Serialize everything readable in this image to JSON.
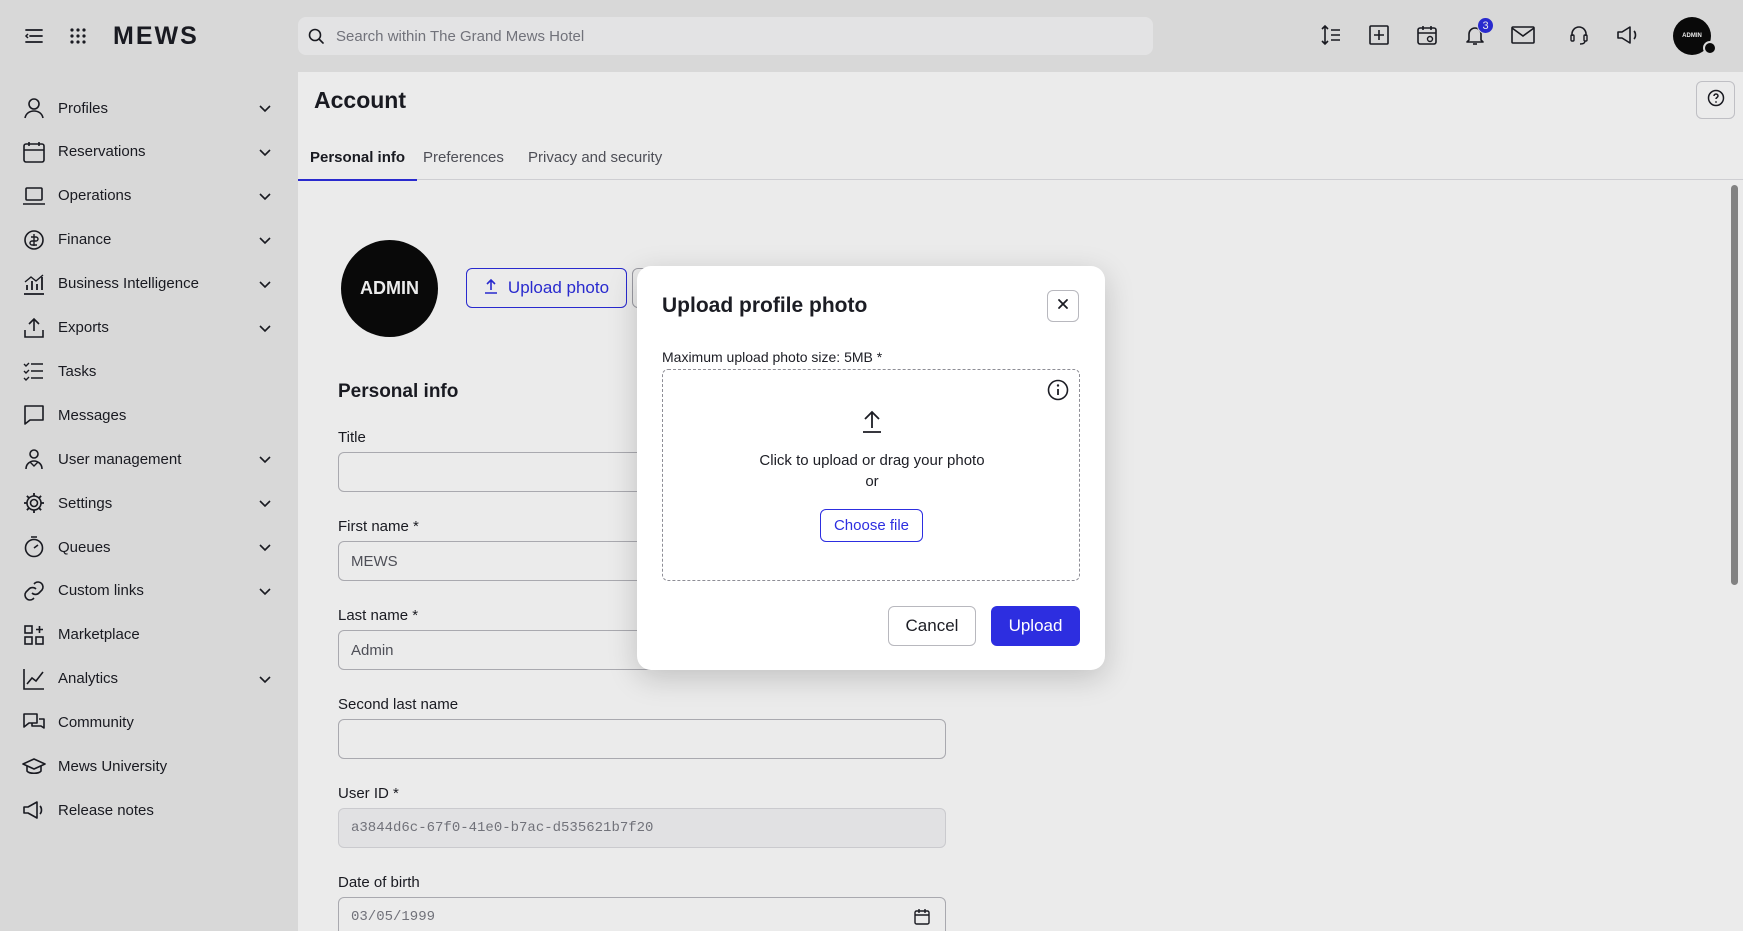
{
  "app": {
    "logo": "MEWS"
  },
  "search": {
    "placeholder": "Search within The Grand Mews Hotel"
  },
  "topbar": {
    "notification_count": "3",
    "avatar_label": "ADMIN",
    "icons": [
      "menu-icon",
      "apps-grid-icon",
      "sort-icon",
      "add-square-icon",
      "calendar-view-icon",
      "bell-icon",
      "mail-icon",
      "support-icon",
      "megaphone-icon"
    ]
  },
  "sidebar": {
    "items": [
      {
        "label": "Profiles",
        "icon": "person-icon",
        "expandable": true
      },
      {
        "label": "Reservations",
        "icon": "calendar-icon",
        "expandable": true
      },
      {
        "label": "Operations",
        "icon": "laptop-icon",
        "expandable": true
      },
      {
        "label": "Finance",
        "icon": "coins-icon",
        "expandable": true
      },
      {
        "label": "Business Intelligence",
        "icon": "bar-chart-icon",
        "expandable": true
      },
      {
        "label": "Exports",
        "icon": "export-icon",
        "expandable": true
      },
      {
        "label": "Tasks",
        "icon": "tasks-icon",
        "expandable": false
      },
      {
        "label": "Messages",
        "icon": "message-icon",
        "expandable": false
      },
      {
        "label": "User management",
        "icon": "users-icon",
        "expandable": true
      },
      {
        "label": "Settings",
        "icon": "gear-icon",
        "expandable": true
      },
      {
        "label": "Queues",
        "icon": "stopwatch-icon",
        "expandable": true
      },
      {
        "label": "Custom links",
        "icon": "link-icon",
        "expandable": true
      },
      {
        "label": "Marketplace",
        "icon": "grid-plus-icon",
        "expandable": false
      },
      {
        "label": "Analytics",
        "icon": "line-chart-icon",
        "expandable": true
      },
      {
        "label": "Community",
        "icon": "chat-bubbles-icon",
        "expandable": false
      },
      {
        "label": "Mews University",
        "icon": "graduation-cap-icon",
        "expandable": false
      },
      {
        "label": "Release notes",
        "icon": "megaphone-icon",
        "expandable": false
      }
    ]
  },
  "main": {
    "title": "Account",
    "tabs": [
      {
        "label": "Personal info",
        "active": true
      },
      {
        "label": "Preferences",
        "active": false
      },
      {
        "label": "Privacy and security",
        "active": false
      }
    ],
    "avatar_label": "ADMIN",
    "upload_photo_label": "Upload photo",
    "section_title": "Personal info",
    "fields": {
      "title": {
        "label": "Title",
        "value": ""
      },
      "first_name": {
        "label": "First name *",
        "value": "MEWS"
      },
      "last_name": {
        "label": "Last name *",
        "value": "Admin"
      },
      "second_last_name": {
        "label": "Second last name",
        "value": ""
      },
      "user_id": {
        "label": "User ID *",
        "value": "a3844d6c-67f0-41e0-b7ac-d535621b7f20"
      },
      "date_of_birth": {
        "label": "Date of birth",
        "value": "03/05/1999"
      }
    }
  },
  "modal": {
    "title": "Upload profile photo",
    "max_size_label": "Maximum upload photo size: 5MB *",
    "dropzone_text": "Click to upload or drag your photo",
    "or_text": "or",
    "choose_file_label": "Choose file",
    "cancel_label": "Cancel",
    "upload_label": "Upload"
  },
  "colors": {
    "accent": "#2d2ee0",
    "sidebar_bg": "#ebebeb",
    "text": "#1c1d24"
  }
}
